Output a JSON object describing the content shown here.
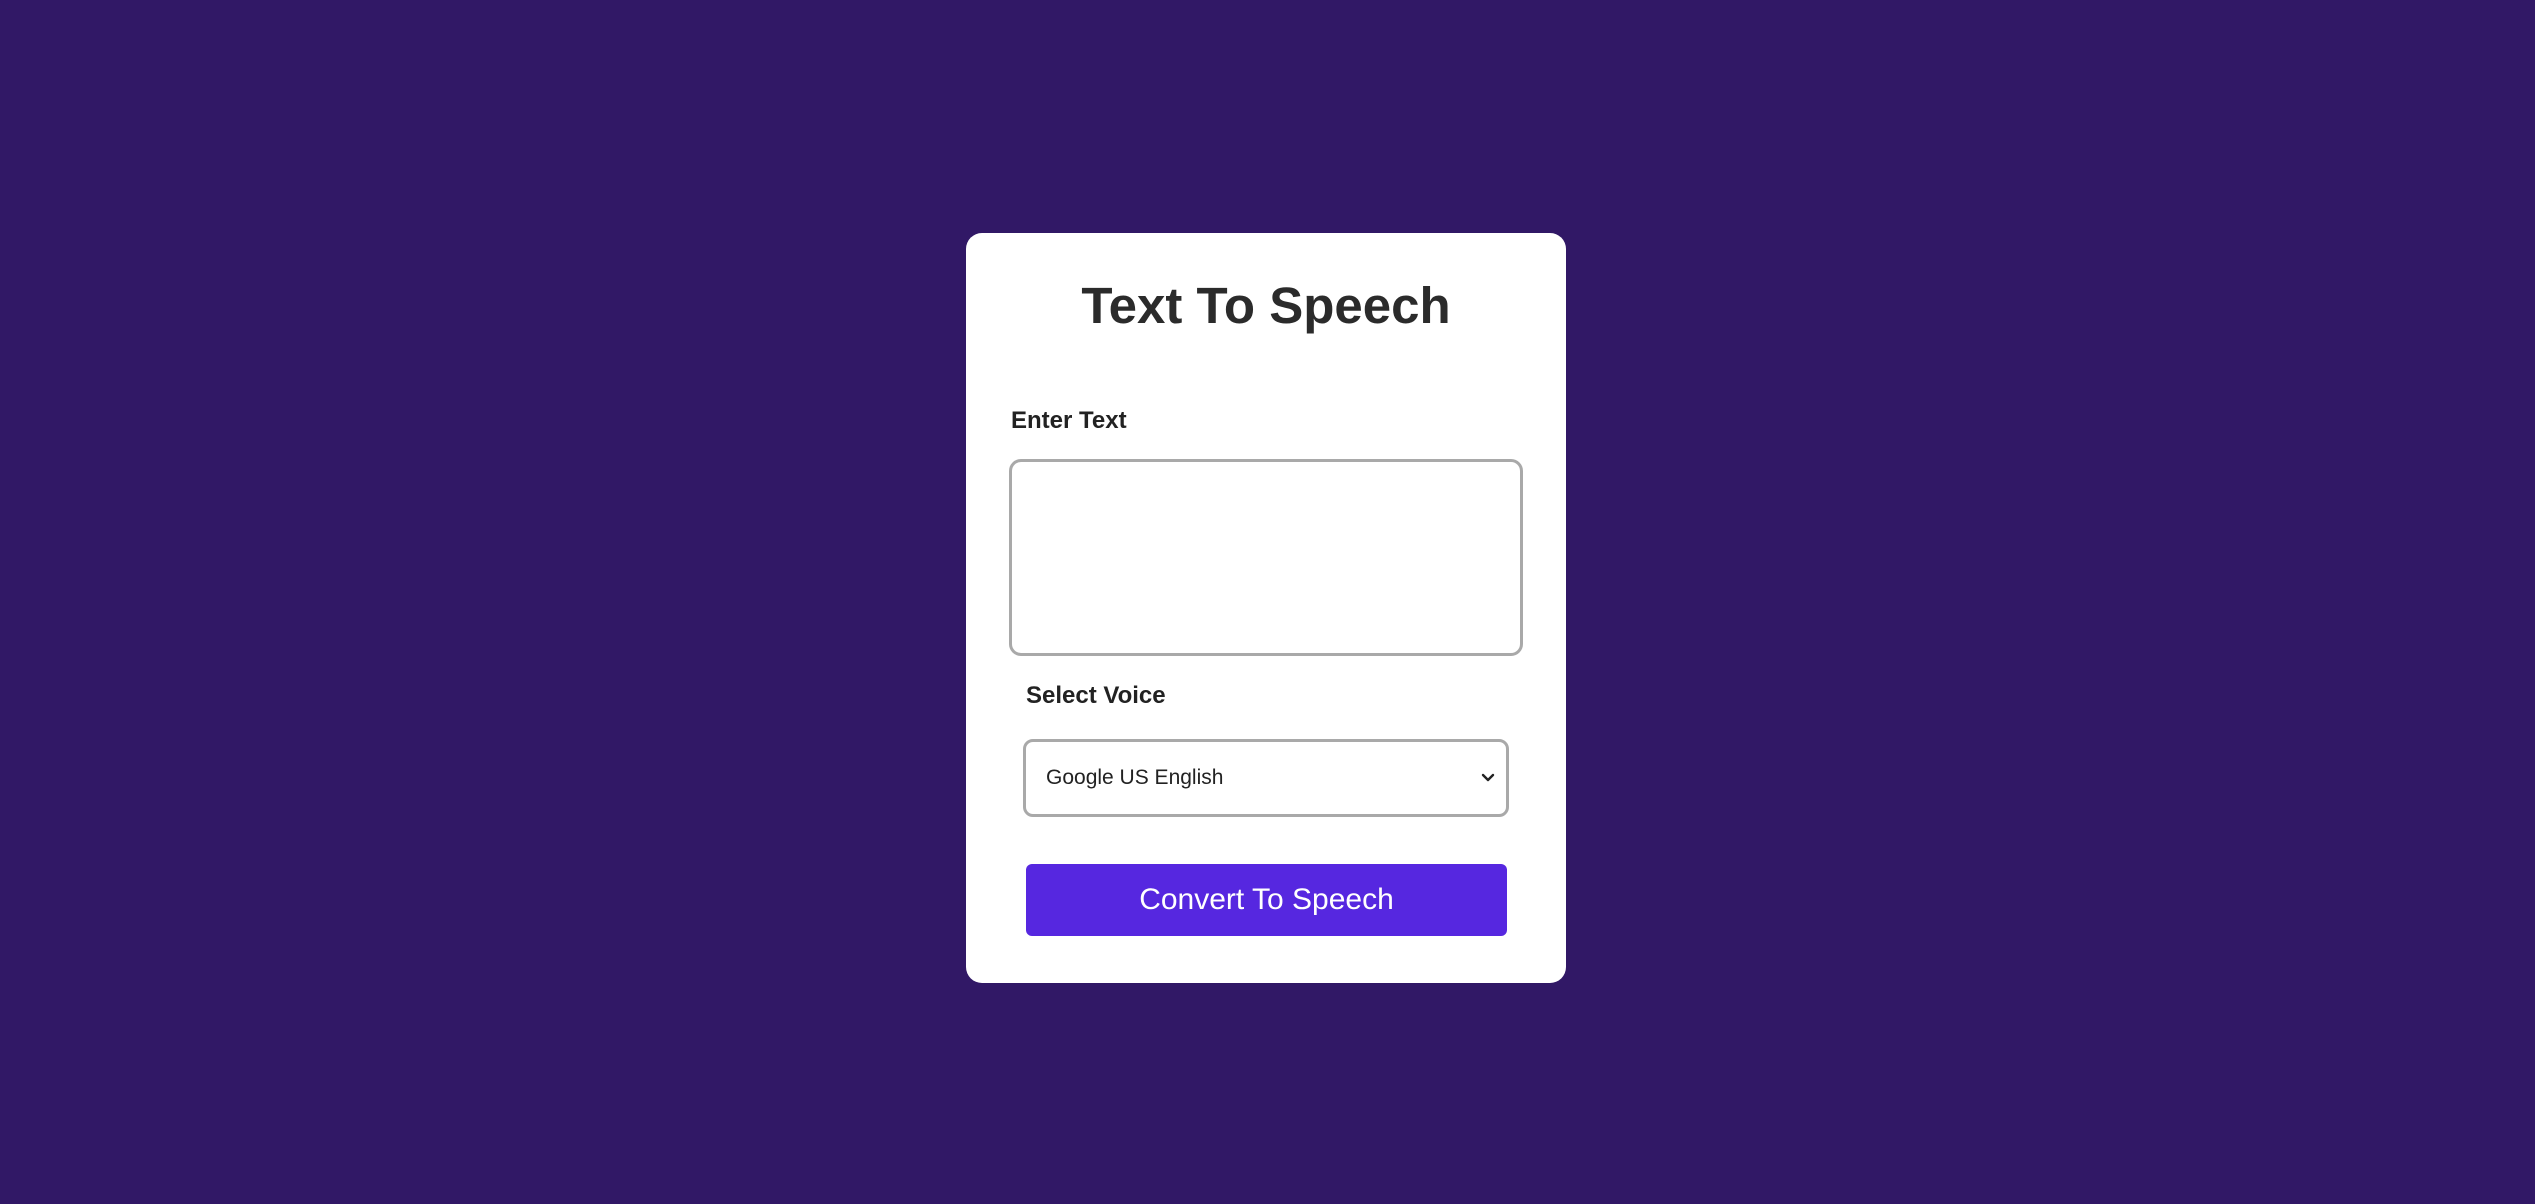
{
  "app": {
    "title": "Text To Speech",
    "background_color": "#311866",
    "accent_color": "#5627e0"
  },
  "text_input": {
    "label": "Enter Text",
    "value": "",
    "placeholder": ""
  },
  "voice_select": {
    "label": "Select Voice",
    "selected": "Google US English",
    "icon": "chevron-down-icon"
  },
  "convert_button": {
    "label": "Convert To Speech"
  }
}
